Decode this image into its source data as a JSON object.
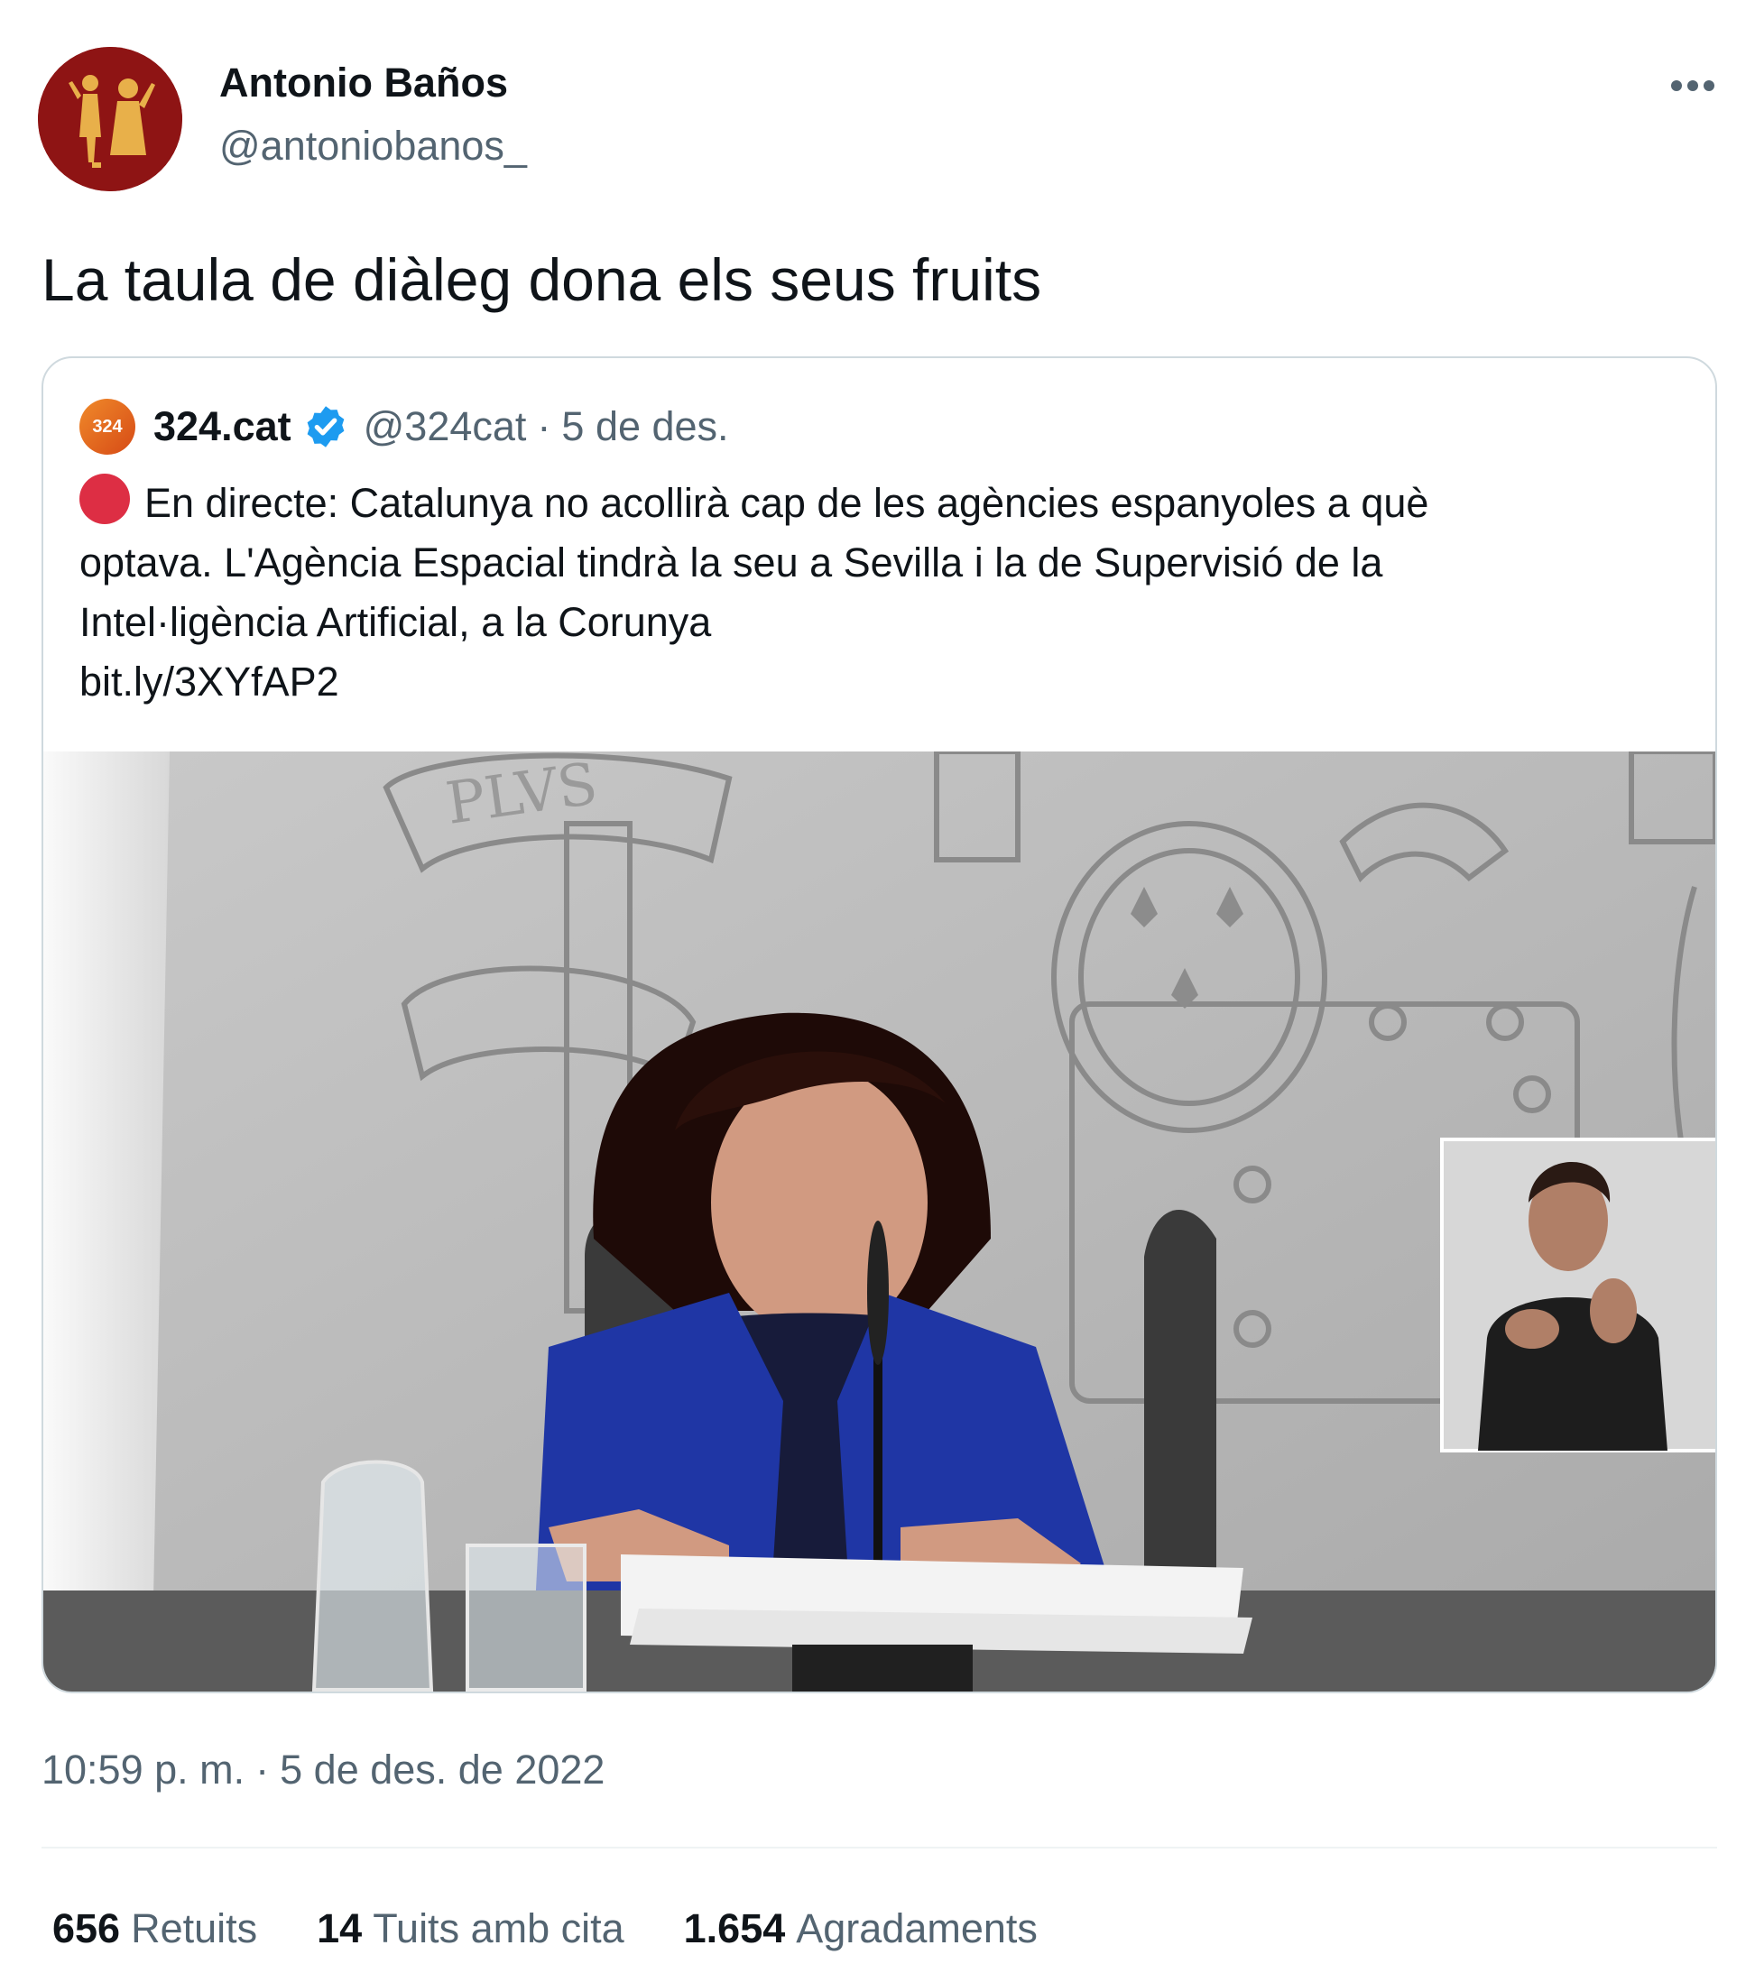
{
  "author": {
    "display_name": "Antonio Baños",
    "handle": "@antoniobanos_",
    "avatar_icon": "illustrated-figures-avatar",
    "avatar_color": "#8e1414"
  },
  "tweet": {
    "text": "La taula de diàleg dona els seus fruits",
    "more_icon": "more-horizontal-icon"
  },
  "quoted_tweet": {
    "avatar_label": "324",
    "name": "324.cat",
    "verified_icon": "verified-badge-icon",
    "verified_color": "#1d9bf0",
    "handle": "@324cat",
    "separator": "·",
    "date": "5 de des.",
    "status_icon": "red-circle-icon",
    "status_color": "#dd2e44",
    "body_line1": "En directe: Catalunya no acollirà cap de les agències espanyoles a què",
    "body_line2": "optava. L'Agència Espacial tindrà la seu a Sevilla i la de Supervisió de la",
    "body_line3": "Intel·ligència Artificial, a la Corunya",
    "link": "bit.ly/3XYfAP2",
    "media_lettering": "PLVS"
  },
  "meta": {
    "time": "10:59 p. m.",
    "separator": "·",
    "date": "5 de des. de 2022"
  },
  "stats": {
    "retweets_count": "656",
    "retweets_label": "Retuits",
    "quotes_count": "14",
    "quotes_label": "Tuits amb cita",
    "likes_count": "1.654",
    "likes_label": "Agradaments"
  }
}
